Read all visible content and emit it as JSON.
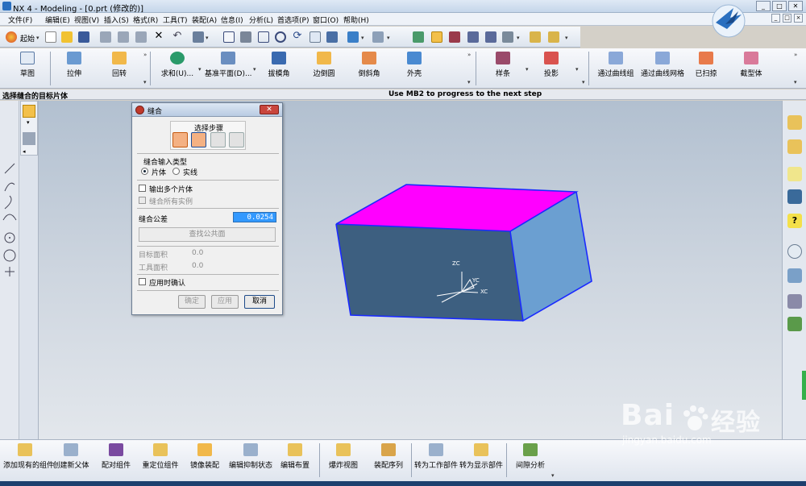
{
  "window": {
    "title": "NX 4 - Modeling - [0.prt (修改的)]",
    "buttons": [
      "_",
      "□",
      "✕"
    ]
  },
  "menu": {
    "items": [
      "文件(F)",
      "编辑(E)",
      "视图(V)",
      "插入(S)",
      "格式(R)",
      "工具(T)",
      "装配(A)",
      "信息(I)",
      "分析(L)",
      "首选项(P)",
      "窗口(O)",
      "帮助(H)"
    ],
    "mdi_buttons": [
      "_",
      "□",
      "×"
    ]
  },
  "toolbar1": {
    "start_label": "起始",
    "icons": [
      "new-icon",
      "open-icon",
      "save-icon",
      "cut-icon",
      "copy-icon",
      "paste-icon",
      "delete-icon",
      "undo-icon",
      "select-icon",
      "fit-icon",
      "zoom-icon",
      "rotate-icon",
      "view-icon",
      "shaded-icon",
      "wireframe-icon",
      "layer-icon",
      "snap-icon",
      "measure-icon",
      "ruler-icon"
    ]
  },
  "toolbar2": {
    "tools": [
      {
        "label": "草图",
        "icon": "sketch-icon"
      },
      {
        "label": "拉伸",
        "icon": "extrude-icon"
      },
      {
        "label": "回转",
        "icon": "revolve-icon"
      },
      {
        "label": "求和(U)...",
        "icon": "unite-icon"
      },
      {
        "label": "基准平面(D)...",
        "icon": "datum-plane-icon"
      },
      {
        "label": "拔模角",
        "icon": "draft-icon"
      },
      {
        "label": "边倒圆",
        "icon": "edge-blend-icon"
      },
      {
        "label": "倒斜角",
        "icon": "chamfer-icon"
      },
      {
        "label": "外壳",
        "icon": "shell-icon"
      },
      {
        "label": "样条",
        "icon": "spline-icon"
      },
      {
        "label": "投影",
        "icon": "project-icon"
      },
      {
        "label": "通过曲线组",
        "icon": "through-curves-icon"
      },
      {
        "label": "通过曲线网格",
        "icon": "curve-mesh-icon"
      },
      {
        "label": "已扫掠",
        "icon": "swept-icon"
      },
      {
        "label": "截型体",
        "icon": "section-body-icon"
      }
    ]
  },
  "cue": {
    "left": "选择缝合的目标片体",
    "center": "Use MB2 to progress to the next step"
  },
  "dialog": {
    "title": "缝合",
    "close": "✕",
    "steps_label": "选择步骤",
    "input_type_label": "缝合输入类型",
    "radio_sheet": "片体",
    "radio_solid": "实线",
    "check_multi": "输出多个片体",
    "check_instances": "缝合所有实例",
    "tolerance_label": "缝合公差",
    "tolerance_value": "0.0254",
    "find_button": "查找公共面",
    "target_area_label": "目标面积",
    "target_area_value": "0.0",
    "tool_area_label": "工具面积",
    "tool_area_value": "0.0",
    "check_confirm": "应用时确认",
    "ok": "确定",
    "apply": "应用",
    "cancel": "取消"
  },
  "triad": {
    "zc": "ZC",
    "yc": "YC",
    "xc": "XC"
  },
  "bottom_toolbar": {
    "tools": [
      {
        "label": "添加现有的组件",
        "icon": "add-component-icon"
      },
      {
        "label": "创建新父体",
        "icon": "new-parent-icon"
      },
      {
        "label": "配对组件",
        "icon": "mate-component-icon"
      },
      {
        "label": "重定位组件",
        "icon": "reposition-icon"
      },
      {
        "label": "镜像装配",
        "icon": "mirror-assembly-icon"
      },
      {
        "label": "编辑抑制状态",
        "icon": "suppression-icon"
      },
      {
        "label": "编辑布置",
        "icon": "arrangement-icon"
      },
      {
        "label": "爆炸视图",
        "icon": "exploded-view-icon"
      },
      {
        "label": "装配序列",
        "icon": "sequence-icon"
      },
      {
        "label": "转为工作部件",
        "icon": "work-part-icon"
      },
      {
        "label": "转为显示部件",
        "icon": "display-part-icon"
      },
      {
        "label": "间隙分析",
        "icon": "clearance-icon"
      }
    ]
  },
  "watermark": {
    "brand": "Bai",
    "brand2": "经验",
    "url": "jingyan.baidu.com"
  },
  "colors": {
    "top_face": "#ff00ff",
    "front_face": "#3d5f80",
    "side_face": "#6b9fd1",
    "edge": "#1a2aff"
  }
}
